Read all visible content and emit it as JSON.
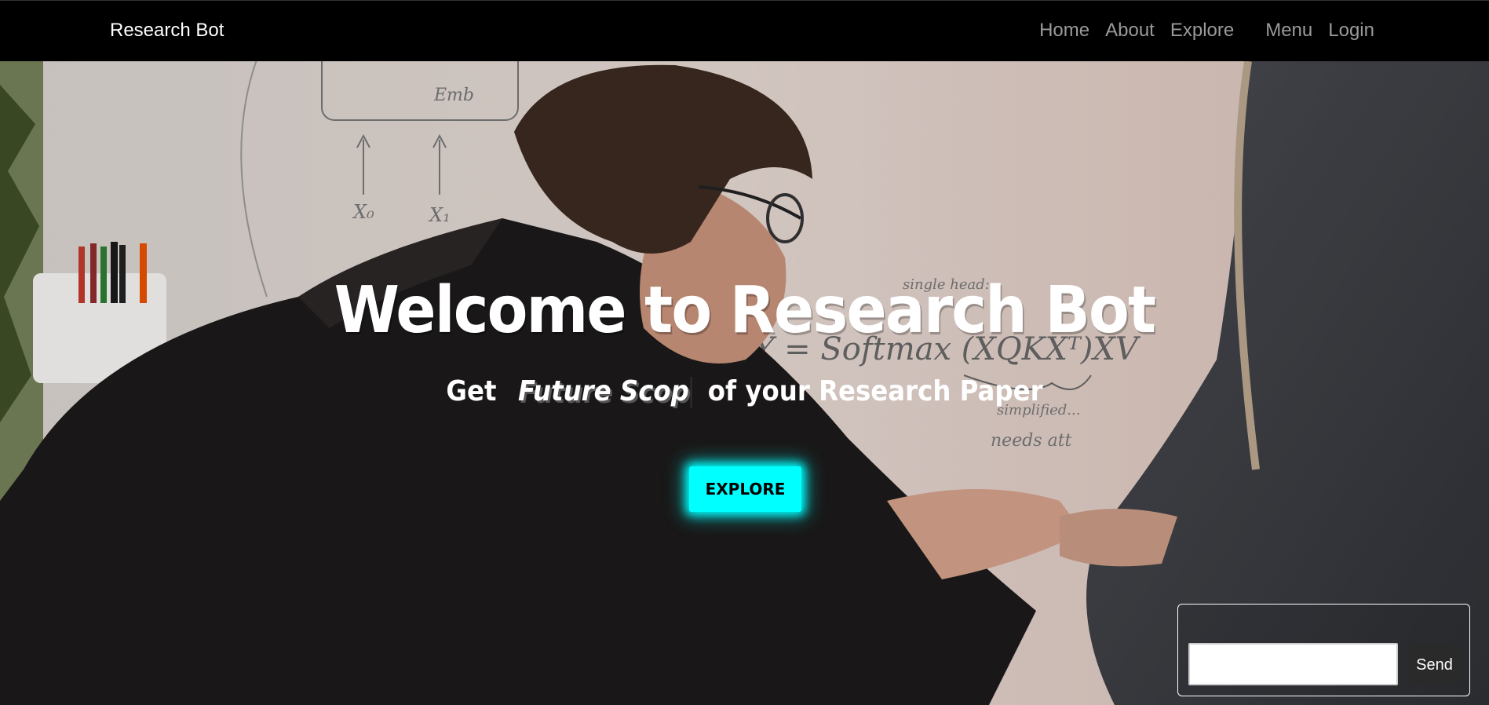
{
  "nav": {
    "brand": "Research Bot",
    "links": [
      "Home",
      "About",
      "Explore",
      "Menu",
      "Login"
    ]
  },
  "hero": {
    "title": "Welcome to Research Bot",
    "subtitle_prefix": "Get",
    "typed_text": "Future Scop",
    "subtitle_suffix": "of your Research Paper",
    "button_label": "EXPLORE",
    "whiteboard": {
      "top_label": "Emb",
      "inputs": [
        "X₀",
        "X₁"
      ],
      "formula": "Y = Softmax (XQKXᵀ)XV",
      "note_head": "single head:",
      "note_simplified": "simplified...",
      "note_needs": "needs att"
    }
  },
  "chat": {
    "input_value": "",
    "input_placeholder": "",
    "send_label": "Send"
  },
  "colors": {
    "accent": "#00ffff",
    "nav_bg": "#000000",
    "nav_link": "#9a9a9a"
  }
}
